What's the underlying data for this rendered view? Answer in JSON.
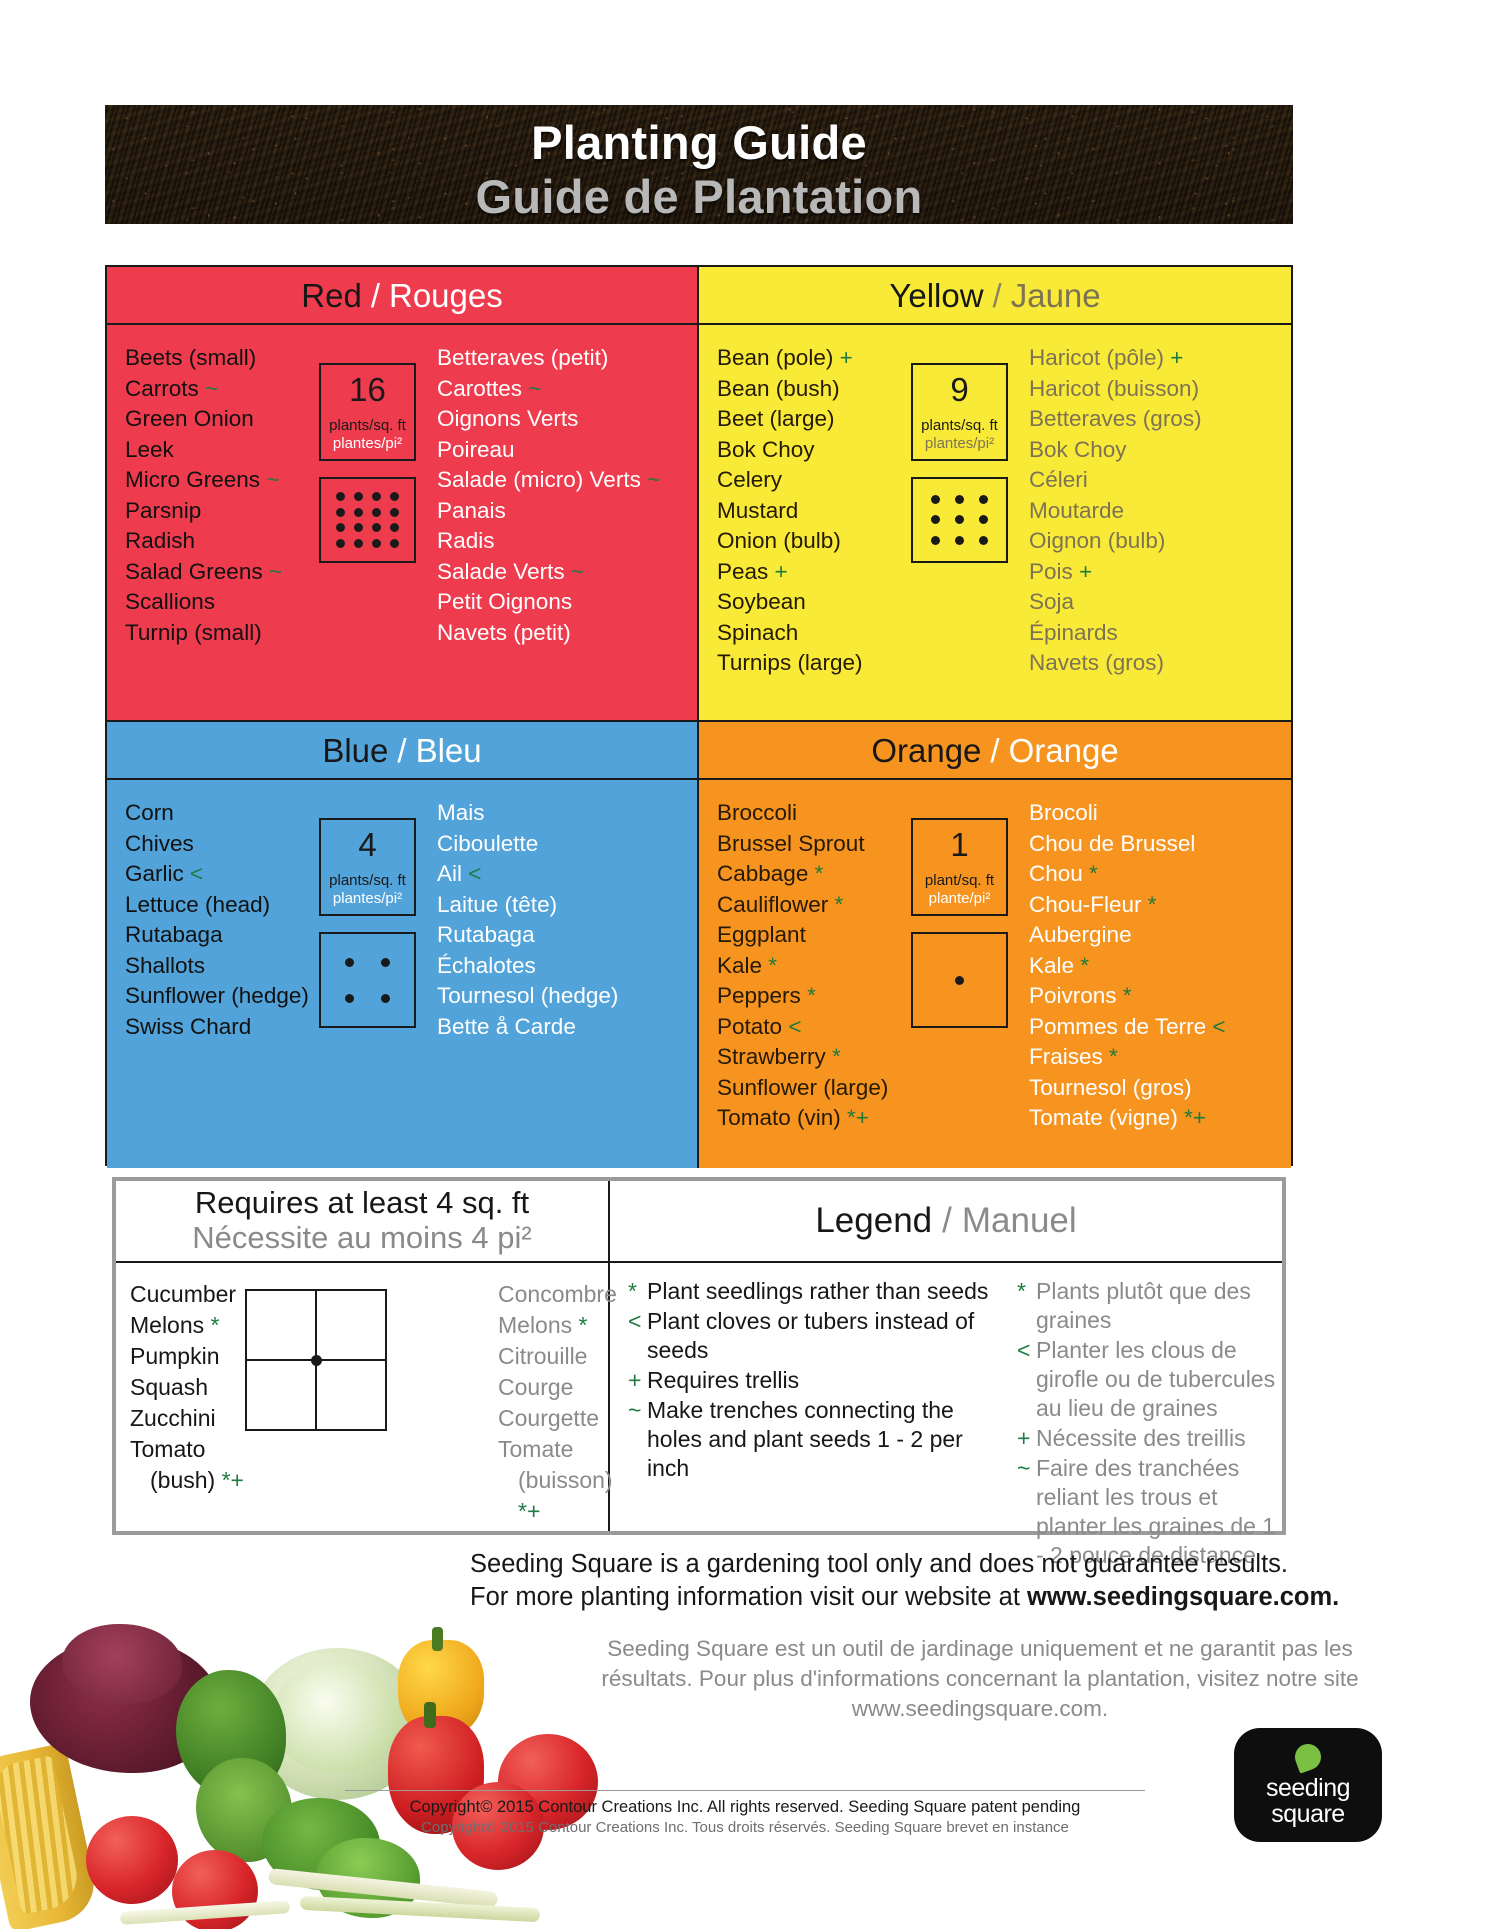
{
  "header": {
    "title_en": "Planting Guide",
    "title_fr": "Guide de Plantation"
  },
  "panels": [
    {
      "key": "red",
      "title_en": "Red",
      "title_fr": "Rouges",
      "density_number": "16",
      "density_unit_en": "plants/sq. ft",
      "density_unit_fr": "plantes/pi²",
      "dots_cols": 4,
      "dots_rows": 4,
      "items_en": [
        "Beets (small)",
        "Carrots ~",
        "Green Onion",
        "Leek",
        "Micro Greens ~",
        "Parsnip",
        "Radish",
        "Salad Greens ~",
        "Scallions",
        "Turnip (small)"
      ],
      "items_fr": [
        "Betteraves (petit)",
        "Carottes ~",
        "Oignons Verts",
        "Poireau",
        "Salade (micro) Verts ~",
        "Panais",
        "Radis",
        "Salade Verts ~",
        "Petit Oignons",
        "Navets (petit)"
      ]
    },
    {
      "key": "yellow",
      "title_en": "Yellow",
      "title_fr": "Jaune",
      "density_number": "9",
      "density_unit_en": "plants/sq. ft",
      "density_unit_fr": "plantes/pi²",
      "dots_cols": 3,
      "dots_rows": 3,
      "items_en": [
        "Bean (pole) +",
        "Bean (bush)",
        "Beet (large)",
        "Bok Choy",
        "Celery",
        "Mustard",
        "Onion (bulb)",
        "Peas +",
        "Soybean",
        "Spinach",
        "Turnips (large)"
      ],
      "items_fr": [
        "Haricot (pôle) +",
        "Haricot (buisson)",
        "Betteraves (gros)",
        "Bok Choy",
        "Céleri",
        "Moutarde",
        "Oignon (bulb)",
        "Pois +",
        "Soja",
        "Épinards",
        "Navets (gros)"
      ]
    },
    {
      "key": "blue",
      "title_en": "Blue",
      "title_fr": "Bleu",
      "density_number": "4",
      "density_unit_en": "plants/sq. ft",
      "density_unit_fr": "plantes/pi²",
      "dots_cols": 2,
      "dots_rows": 2,
      "items_en": [
        "Corn",
        "Chives",
        "Garlic <",
        "Lettuce (head)",
        "Rutabaga",
        "Shallots",
        "Sunflower (hedge)",
        "Swiss Chard"
      ],
      "items_fr": [
        "Mais",
        "Ciboulette",
        "Ail <",
        "Laitue (tête)",
        "Rutabaga",
        "Échalotes",
        "Tournesol (hedge)",
        "Bette å Carde"
      ]
    },
    {
      "key": "orange",
      "title_en": "Orange",
      "title_fr": "Orange",
      "density_number": "1",
      "density_unit_en": "plant/sq. ft",
      "density_unit_fr": "plante/pi²",
      "dots_cols": 1,
      "dots_rows": 1,
      "items_en": [
        "Broccoli",
        "Brussel Sprout",
        "Cabbage *",
        "Cauliflower *",
        "Eggplant",
        "Kale *",
        "Peppers *",
        "Potato <",
        "Strawberry *",
        "Sunflower (large)",
        "Tomato (vin) *+"
      ],
      "items_fr": [
        "Brocoli",
        "Chou de Brussel",
        "Chou *",
        "Chou-Fleur *",
        "Aubergine",
        "Kale *",
        "Poivrons *",
        "Pommes de Terre <",
        "Fraises *",
        "Tournesol (gros)",
        "Tomate (vigne) *+"
      ]
    }
  ],
  "requires": {
    "title_en": "Requires at least 4 sq. ft",
    "title_fr": "Nécessite au moins 4 pi²",
    "items_en": [
      "Cucumber",
      "Melons *",
      "Pumpkin",
      "Squash",
      "Zucchini",
      "Tomato",
      "(bush) *+"
    ],
    "items_fr": [
      "Concombre",
      "Melons *",
      "Citrouille",
      "Courge",
      "Courgette",
      "Tomate",
      "(buisson) *+"
    ]
  },
  "legend": {
    "title_en": "Legend",
    "title_fr": "Manuel",
    "items_en": [
      {
        "symbol": "*",
        "text": "Plant seedlings rather than seeds"
      },
      {
        "symbol": "<",
        "text": "Plant cloves or tubers instead of seeds"
      },
      {
        "symbol": "+",
        "text": "Requires trellis"
      },
      {
        "symbol": "~",
        "text": "Make trenches connecting the holes and plant seeds 1 - 2 per inch"
      }
    ],
    "items_fr": [
      {
        "symbol": "*",
        "text": "Plants plutôt que des graines"
      },
      {
        "symbol": "<",
        "text": "Planter les clous de girofle ou de tubercules au lieu de graines"
      },
      {
        "symbol": "+",
        "text": "Nécessite des treillis"
      },
      {
        "symbol": "~",
        "text": "Faire des tranchées reliant les trous et planter les graines de 1 - 2 pouce de distance"
      }
    ]
  },
  "footer": {
    "en_line1": "Seeding Square is a gardening tool only and does not guarantee results.",
    "en_line2_pre": "For more planting information visit our website at ",
    "en_line2_bold": "www.seedingsquare.com.",
    "fr_text": "Seeding Square est un outil de jardinage uniquement et ne garantit pas les résultats. Pour plus d'informations concernant la plantation, visitez notre site www.seedingsquare.com.",
    "copyright_en": "Copyright© 2015 Contour Creations Inc.  All rights reserved.  Seeding Square patent pending",
    "copyright_fr": "Copyright© 2015 Contour Creations Inc. Tous droits réservés. Seeding Square brevet en instance"
  },
  "logo": {
    "line1": "seeding",
    "line2": "square"
  },
  "colors": {
    "red": "#ef3b4e",
    "yellow": "#f9ea37",
    "blue": "#52a3d9",
    "orange": "#f79420",
    "symbol_green": "#1f7a43",
    "gray_text": "#8a8a8a"
  }
}
